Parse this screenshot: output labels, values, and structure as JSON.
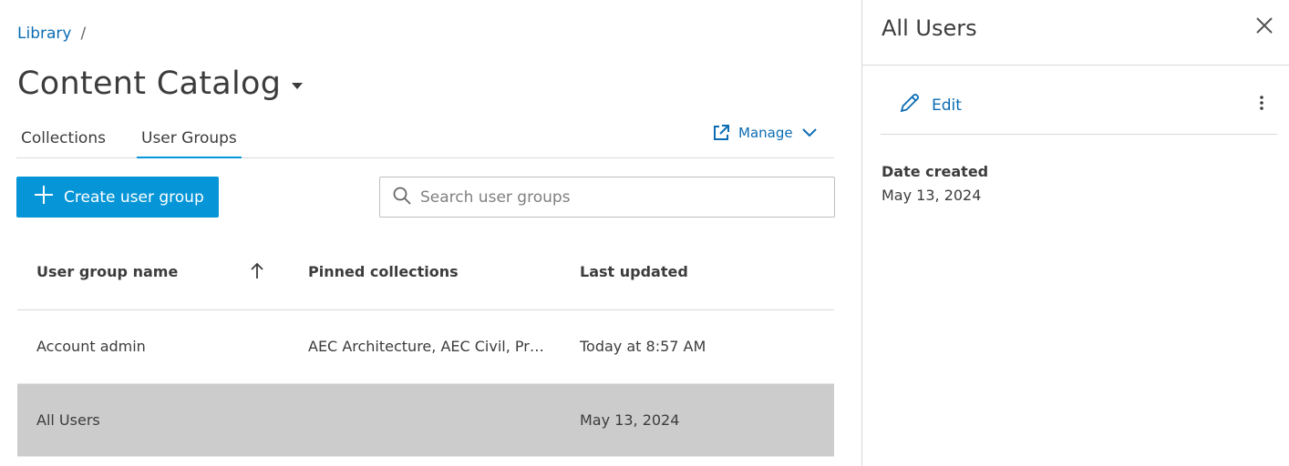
{
  "breadcrumb": {
    "items": [
      "Library"
    ],
    "separator": "/"
  },
  "page": {
    "title": "Content Catalog"
  },
  "tabs": [
    {
      "label": "Collections",
      "active": false
    },
    {
      "label": "User Groups",
      "active": true
    }
  ],
  "manage": {
    "label": "Manage"
  },
  "toolbar": {
    "create_label": "Create user group"
  },
  "search": {
    "placeholder": "Search user groups",
    "value": ""
  },
  "table": {
    "columns": [
      "User group name",
      "Pinned collections",
      "Last updated"
    ],
    "rows": [
      {
        "name": "Account admin",
        "pinned": "AEC Architecture, AEC Civil, Pr…",
        "updated": "Today at 8:57 AM",
        "selected": false
      },
      {
        "name": "All Users",
        "pinned": "",
        "updated": "May 13, 2024",
        "selected": true
      }
    ]
  },
  "panel": {
    "title": "All Users",
    "edit_label": "Edit",
    "date_created_label": "Date created",
    "date_created_value": "May 13, 2024"
  },
  "colors": {
    "accent": "#0696d7",
    "link": "#0b6cb3",
    "selected_row": "#cccccc"
  },
  "icons": [
    "external-link-icon",
    "chevron-down-icon",
    "plus-icon",
    "search-icon",
    "sort-arrow-up-icon",
    "close-icon",
    "pencil-icon",
    "more-vertical-icon",
    "caret-down-icon"
  ]
}
